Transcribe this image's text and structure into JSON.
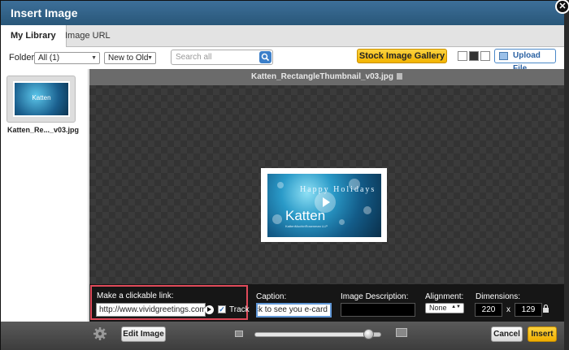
{
  "dialog": {
    "title": "Insert Image"
  },
  "tabs": [
    {
      "label": "My Library"
    },
    {
      "label": "Image URL"
    }
  ],
  "toolbar": {
    "folder_label": "Folder:",
    "folder_value": "All (1)",
    "sort_value": "New to Old",
    "search_placeholder": "Search all",
    "stock_gallery_label": "Stock Image Gallery",
    "upload_label": "Upload File"
  },
  "library": {
    "items": [
      {
        "label": "Katten_Re..._v03.jpg"
      }
    ]
  },
  "preview": {
    "filename": "Katten_RectangleThumbnail_v03.jpg",
    "card_greeting": "Happy Holidays",
    "card_brand": "Katten",
    "card_subtext": "KattenMuchinRosenman LLP"
  },
  "properties": {
    "link_label": "Make a clickable link:",
    "link_value": "http://www.vividgreetings.com/ac",
    "track_label": "Track",
    "caption_label": "Caption:",
    "caption_value": "Click to see you e-card",
    "description_label": "Image Description:",
    "description_value": "",
    "alignment_label": "Alignment:",
    "alignment_value": "None",
    "dimensions_label": "Dimensions:",
    "width": "220",
    "times": "x",
    "height": "129"
  },
  "zoom": {
    "level": 0.9
  },
  "footer": {
    "edit_label": "Edit Image",
    "cancel_label": "Cancel",
    "insert_label": "Insert"
  }
}
